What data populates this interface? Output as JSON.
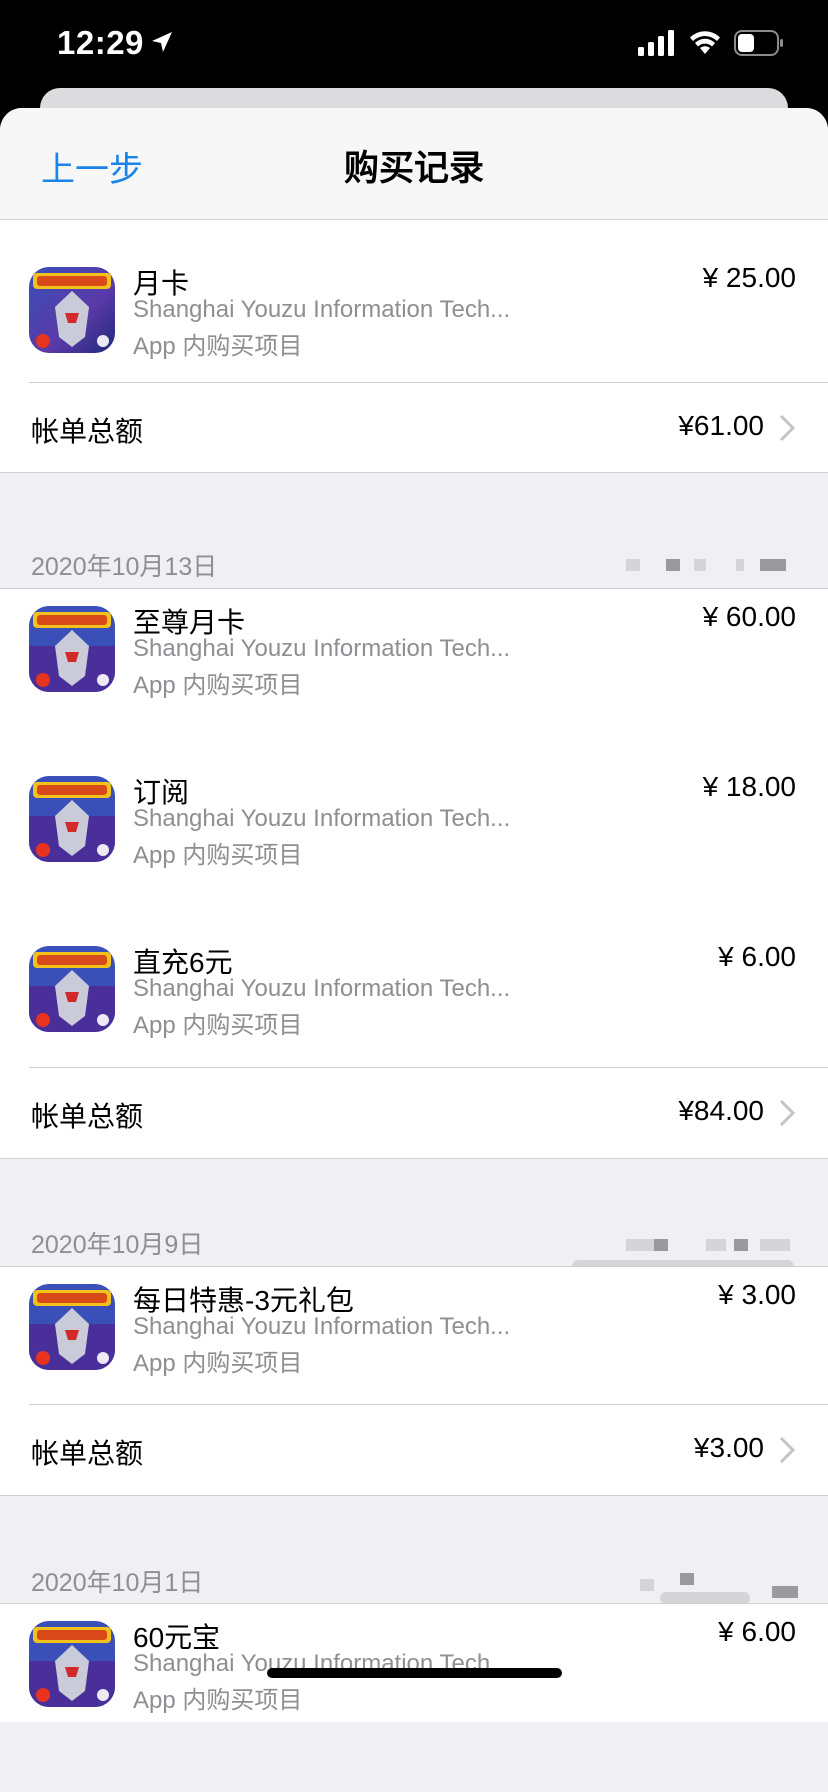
{
  "status_bar": {
    "time": "12:29"
  },
  "nav": {
    "back_label": "上一步",
    "title": "购买记录"
  },
  "sections": [
    {
      "date": "",
      "items": [
        {
          "name": "月卡",
          "developer": "Shanghai Youzu Information Tech...",
          "type": "App 内购买项目",
          "price": "¥ 25.00"
        }
      ],
      "total_label": "帐单总额",
      "total_amount": "¥61.00"
    },
    {
      "date": "2020年10月13日",
      "items": [
        {
          "name": "至尊月卡",
          "developer": "Shanghai Youzu Information Tech...",
          "type": "App 内购买项目",
          "price": "¥ 60.00"
        },
        {
          "name": "订阅",
          "developer": "Shanghai Youzu Information Tech...",
          "type": "App 内购买项目",
          "price": "¥ 18.00"
        },
        {
          "name": "直充6元",
          "developer": "Shanghai Youzu Information Tech...",
          "type": "App 内购买项目",
          "price": "¥ 6.00"
        }
      ],
      "total_label": "帐单总额",
      "total_amount": "¥84.00"
    },
    {
      "date": "2020年10月9日",
      "items": [
        {
          "name": "每日特惠-3元礼包",
          "developer": "Shanghai Youzu Information Tech...",
          "type": "App 内购买项目",
          "price": "¥ 3.00"
        }
      ],
      "total_label": "帐单总额",
      "total_amount": "¥3.00"
    },
    {
      "date": "2020年10月1日",
      "items": [
        {
          "name": "60元宝",
          "developer": "Shanghai Youzu Information Tech...",
          "type": "App 内购买项目",
          "price": "¥ 6.00"
        }
      ]
    }
  ],
  "colors": {
    "accent": "#1a84e8",
    "secondary_text": "#8e8e93",
    "background": "#efeff4",
    "separator": "#d0d0d4"
  }
}
